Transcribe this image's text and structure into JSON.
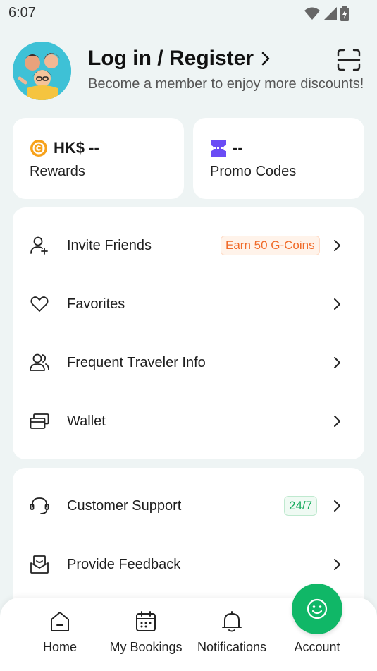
{
  "status_bar": {
    "time": "6:07",
    "icons": [
      "wifi-icon",
      "signal-icon",
      "battery-icon"
    ]
  },
  "header": {
    "title": "Log in / Register",
    "subtitle": "Become a member to enjoy more discounts!"
  },
  "rewards": {
    "value": "HK$ --",
    "label": "Rewards"
  },
  "promo": {
    "value": "--",
    "label": "Promo Codes"
  },
  "menu": [
    {
      "label": "Invite Friends",
      "icon": "add-user-icon",
      "badge": "Earn 50 G-Coins"
    },
    {
      "label": "Favorites",
      "icon": "heart-icon"
    },
    {
      "label": "Frequent Traveler Info",
      "icon": "users-icon"
    },
    {
      "label": "Wallet",
      "icon": "wallet-icon"
    }
  ],
  "menu2": [
    {
      "label": "Customer Support",
      "icon": "headset-icon",
      "badge": "24/7"
    },
    {
      "label": "Provide Feedback",
      "icon": "feedback-icon"
    }
  ],
  "nav": [
    {
      "label": "Home",
      "icon": "home-icon"
    },
    {
      "label": "My Bookings",
      "icon": "calendar-icon"
    },
    {
      "label": "Notifications",
      "icon": "bell-icon"
    },
    {
      "label": "Account",
      "icon": "smile-icon",
      "active": true
    }
  ],
  "colors": {
    "accent": "#10b767",
    "orange": "#f06a28",
    "background": "#eef4f4",
    "purple": "#6a4cf5",
    "coin": "#f7a21b"
  }
}
